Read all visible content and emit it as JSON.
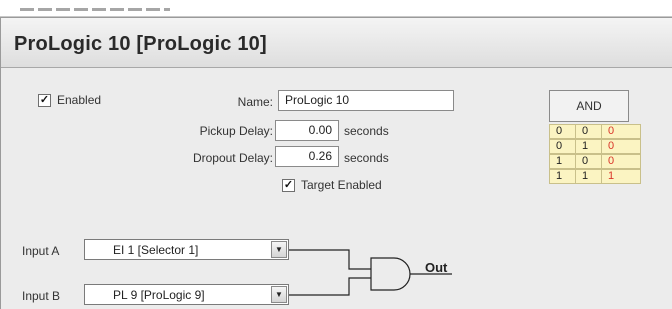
{
  "window": {
    "title": "ProLogic 10 [ProLogic 10]"
  },
  "form": {
    "enabled": {
      "label": "Enabled",
      "checked": true
    },
    "name": {
      "label": "Name:",
      "value": "ProLogic 10"
    },
    "pickup_delay": {
      "label": "Pickup Delay:",
      "value": "0.00",
      "unit": "seconds"
    },
    "dropout_delay": {
      "label": "Dropout Delay:",
      "value": "0.26",
      "unit": "seconds"
    },
    "target_enabled": {
      "label": "Target Enabled",
      "checked": true
    }
  },
  "truth_table": {
    "gate": "AND",
    "rows": [
      [
        "0",
        "0",
        "0"
      ],
      [
        "0",
        "1",
        "0"
      ],
      [
        "1",
        "0",
        "0"
      ],
      [
        "1",
        "1",
        "1"
      ]
    ]
  },
  "inputs": {
    "a": {
      "label": "Input A",
      "value": "EI 1 [Selector 1]"
    },
    "b": {
      "label": "Input B",
      "value": "PL 9 [ProLogic 9]"
    }
  },
  "diagram": {
    "output_label": "Out"
  },
  "icons": {
    "checkbox_checked": "check-icon",
    "dropdown": "triangle-down-icon"
  }
}
